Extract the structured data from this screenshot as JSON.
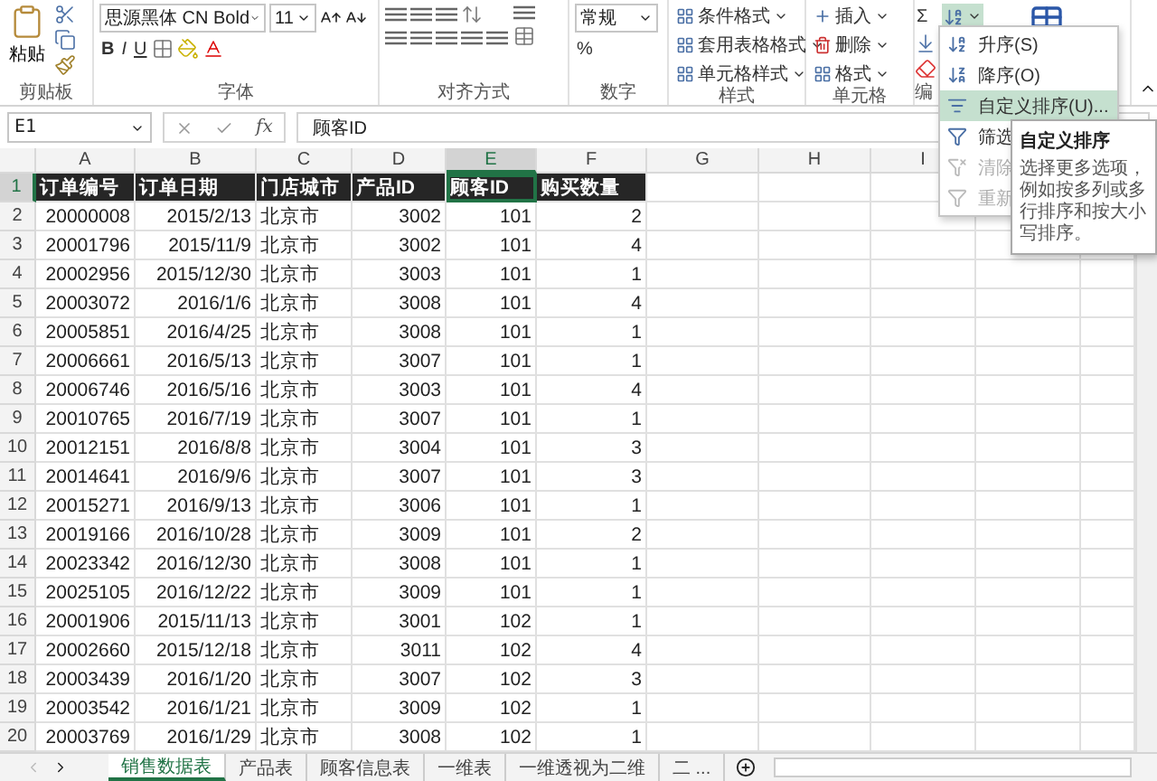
{
  "ribbon": {
    "groups": [
      {
        "kind": "clipboard",
        "label": "剪贴板",
        "paste": "粘贴"
      },
      {
        "kind": "font",
        "label": "字体",
        "font": "思源黑体 CN Bold",
        "size": "11",
        "styles": [
          "B",
          "I",
          "U"
        ]
      },
      {
        "kind": "align",
        "label": "对齐方式"
      },
      {
        "kind": "number",
        "label": "数字",
        "format": "常规",
        "percent": "%"
      },
      {
        "kind": "styles",
        "label": "样式",
        "items": [
          "条件格式",
          "套用表格格式",
          "单元格样式"
        ]
      },
      {
        "kind": "cells",
        "label": "单元格",
        "items": [
          "插入",
          "删除",
          "格式"
        ]
      },
      {
        "kind": "editing",
        "label": "编",
        "sum": "Σ",
        "sort_pressed": true
      }
    ]
  },
  "formula_bar": {
    "name_box": "E1",
    "fx": "fx",
    "value": "顾客ID"
  },
  "sheet": {
    "columns": [
      {
        "label": "A",
        "selected": false
      },
      {
        "label": "B",
        "selected": false
      },
      {
        "label": "C",
        "selected": false
      },
      {
        "label": "D",
        "selected": false
      },
      {
        "label": "E",
        "selected": true
      },
      {
        "label": "F",
        "selected": false
      },
      {
        "label": "G",
        "selected": false
      },
      {
        "label": "H",
        "selected": false
      },
      {
        "label": "I",
        "selected": false
      }
    ],
    "header_row": {
      "number": "1",
      "selected": true,
      "cells": [
        {
          "text": "订单编号",
          "selected": false
        },
        {
          "text": "订单日期",
          "selected": false
        },
        {
          "text": "门店城市",
          "selected": false
        },
        {
          "text": "产品ID",
          "selected": false
        },
        {
          "text": "顾客ID",
          "selected": true
        },
        {
          "text": "购买数量",
          "selected": false
        }
      ]
    },
    "rows": [
      {
        "number": "2",
        "selected": false,
        "cells": [
          "20000008",
          "2015/2/13",
          "北京市",
          "3002",
          "101",
          "2"
        ]
      },
      {
        "number": "3",
        "selected": false,
        "cells": [
          "20001796",
          "2015/11/9",
          "北京市",
          "3002",
          "101",
          "4"
        ]
      },
      {
        "number": "4",
        "selected": false,
        "cells": [
          "20002956",
          "2015/12/30",
          "北京市",
          "3003",
          "101",
          "1"
        ]
      },
      {
        "number": "5",
        "selected": false,
        "cells": [
          "20003072",
          "2016/1/6",
          "北京市",
          "3008",
          "101",
          "4"
        ]
      },
      {
        "number": "6",
        "selected": false,
        "cells": [
          "20005851",
          "2016/4/25",
          "北京市",
          "3008",
          "101",
          "1"
        ]
      },
      {
        "number": "7",
        "selected": false,
        "cells": [
          "20006661",
          "2016/5/13",
          "北京市",
          "3007",
          "101",
          "1"
        ]
      },
      {
        "number": "8",
        "selected": false,
        "cells": [
          "20006746",
          "2016/5/16",
          "北京市",
          "3003",
          "101",
          "4"
        ]
      },
      {
        "number": "9",
        "selected": false,
        "cells": [
          "20010765",
          "2016/7/19",
          "北京市",
          "3007",
          "101",
          "1"
        ]
      },
      {
        "number": "10",
        "selected": false,
        "cells": [
          "20012151",
          "2016/8/8",
          "北京市",
          "3004",
          "101",
          "3"
        ]
      },
      {
        "number": "11",
        "selected": false,
        "cells": [
          "20014641",
          "2016/9/6",
          "北京市",
          "3007",
          "101",
          "3"
        ]
      },
      {
        "number": "12",
        "selected": false,
        "cells": [
          "20015271",
          "2016/9/13",
          "北京市",
          "3006",
          "101",
          "1"
        ]
      },
      {
        "number": "13",
        "selected": false,
        "cells": [
          "20019166",
          "2016/10/28",
          "北京市",
          "3009",
          "101",
          "2"
        ]
      },
      {
        "number": "14",
        "selected": false,
        "cells": [
          "20023342",
          "2016/12/30",
          "北京市",
          "3008",
          "101",
          "1"
        ]
      },
      {
        "number": "15",
        "selected": false,
        "cells": [
          "20025105",
          "2016/12/22",
          "北京市",
          "3009",
          "101",
          "1"
        ]
      },
      {
        "number": "16",
        "selected": false,
        "cells": [
          "20001906",
          "2015/11/13",
          "北京市",
          "3001",
          "102",
          "1"
        ]
      },
      {
        "number": "17",
        "selected": false,
        "cells": [
          "20002660",
          "2015/12/18",
          "北京市",
          "3011",
          "102",
          "4"
        ]
      },
      {
        "number": "18",
        "selected": false,
        "cells": [
          "20003439",
          "2016/1/20",
          "北京市",
          "3007",
          "102",
          "3"
        ]
      },
      {
        "number": "19",
        "selected": false,
        "cells": [
          "20003542",
          "2016/1/21",
          "北京市",
          "3009",
          "102",
          "1"
        ]
      },
      {
        "number": "20",
        "selected": false,
        "cells": [
          "20003769",
          "2016/1/29",
          "北京市",
          "3008",
          "102",
          "1"
        ]
      }
    ]
  },
  "sort_menu": {
    "items": [
      {
        "kind": "ascending",
        "label": "升序(S)",
        "disabled": false,
        "selected": false
      },
      {
        "kind": "descending",
        "label": "降序(O)",
        "disabled": false,
        "selected": false
      },
      {
        "kind": "custom",
        "label": "自定义排序(U)...",
        "disabled": false,
        "selected": true
      },
      {
        "kind": "filter",
        "label": "筛选",
        "disabled": false,
        "selected": false
      },
      {
        "kind": "clear",
        "label": "清除",
        "disabled": true,
        "selected": false
      },
      {
        "kind": "reapply",
        "label": "重新",
        "disabled": true,
        "selected": false
      }
    ]
  },
  "tooltip": {
    "title": "自定义排序",
    "body": "选择更多选项，例如按多列或多行排序和按大小写排序。"
  },
  "sheet_tabs": [
    {
      "label": "销售数据表",
      "selected": true
    },
    {
      "label": "产品表",
      "selected": false
    },
    {
      "label": "顾客信息表",
      "selected": false
    },
    {
      "label": "一维表",
      "selected": false
    },
    {
      "label": "一维透视为二维",
      "selected": false
    },
    {
      "label": "二 ...",
      "selected": false
    }
  ]
}
